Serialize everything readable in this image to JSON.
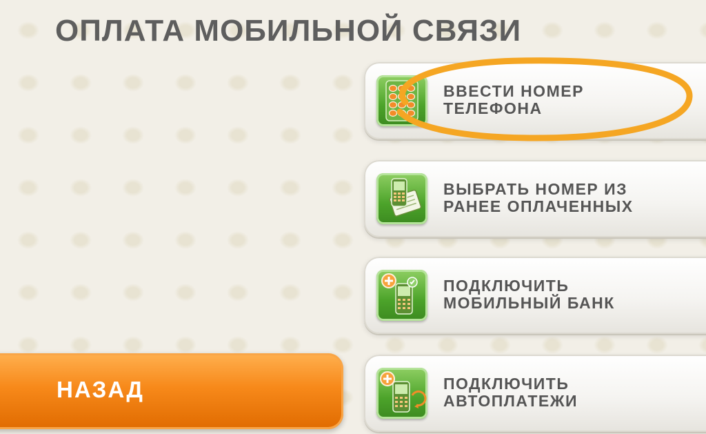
{
  "screen": {
    "title": "ОПЛАТА МОБИЛЬНОЙ СВЯЗИ"
  },
  "menu": [
    {
      "label": "ВВЕСТИ НОМЕР\nТЕЛЕФОНА",
      "icon": "keypad-icon"
    },
    {
      "label": "ВЫБРАТЬ НОМЕР ИЗ\nРАНЕЕ ОПЛАЧЕННЫХ",
      "icon": "phone-list-icon"
    },
    {
      "label": "ПОДКЛЮЧИТЬ\nМОБИЛЬНЫЙ БАНК",
      "icon": "mobile-bank-icon"
    },
    {
      "label": "ПОДКЛЮЧИТЬ\nАВТОПЛАТЕЖИ",
      "icon": "autopay-icon"
    }
  ],
  "back": {
    "label": "НАЗАД"
  },
  "colors": {
    "accent": "#f7891a",
    "highlight": "#f5a623",
    "icon_green": "#4ca32a",
    "text": "#5e5e5e"
  }
}
